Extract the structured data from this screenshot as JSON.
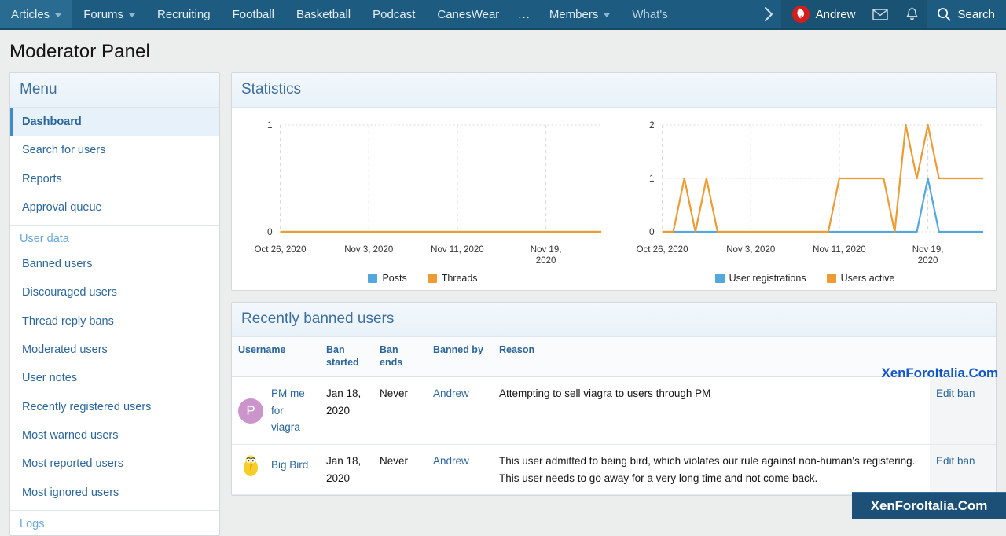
{
  "navbar": {
    "items": [
      {
        "label": "Articles",
        "has_caret": true
      },
      {
        "label": "Forums",
        "has_caret": true
      },
      {
        "label": "Recruiting",
        "has_caret": false
      },
      {
        "label": "Football",
        "has_caret": false
      },
      {
        "label": "Basketball",
        "has_caret": false
      },
      {
        "label": "Podcast",
        "has_caret": false
      },
      {
        "label": "CanesWear",
        "has_caret": false
      },
      {
        "label": "...",
        "has_caret": false
      },
      {
        "label": "Members",
        "has_caret": true
      },
      {
        "label": "What's",
        "has_caret": false
      }
    ],
    "scroll_right_icon": "chevron-right-icon",
    "username": "Andrew",
    "inbox_icon": "envelope-icon",
    "alerts_icon": "bell-icon",
    "search_label": "Search",
    "search_icon": "magnifier-icon",
    "bg_color": "#1e5b80",
    "avatar_color": "#d41e1e"
  },
  "page": {
    "title": "Moderator Panel"
  },
  "sidebar": {
    "header": "Menu",
    "items": [
      {
        "label": "Dashboard",
        "active": true,
        "type": "item"
      },
      {
        "label": "Search for users",
        "active": false,
        "type": "item"
      },
      {
        "label": "Reports",
        "active": false,
        "type": "item"
      },
      {
        "label": "Approval queue",
        "active": false,
        "type": "item"
      },
      {
        "label": "User data",
        "active": false,
        "type": "section"
      },
      {
        "label": "Banned users",
        "active": false,
        "type": "item"
      },
      {
        "label": "Discouraged users",
        "active": false,
        "type": "item"
      },
      {
        "label": "Thread reply bans",
        "active": false,
        "type": "item"
      },
      {
        "label": "Moderated users",
        "active": false,
        "type": "item"
      },
      {
        "label": "User notes",
        "active": false,
        "type": "item"
      },
      {
        "label": "Recently registered users",
        "active": false,
        "type": "item"
      },
      {
        "label": "Most warned users",
        "active": false,
        "type": "item"
      },
      {
        "label": "Most reported users",
        "active": false,
        "type": "item"
      },
      {
        "label": "Most ignored users",
        "active": false,
        "type": "item"
      },
      {
        "label": "Logs",
        "active": false,
        "type": "section"
      }
    ]
  },
  "statistics": {
    "header": "Statistics"
  },
  "banned": {
    "header": "Recently banned users",
    "columns": [
      "Username",
      "Ban started",
      "Ban ends",
      "Banned by",
      "Reason",
      ""
    ],
    "rows": [
      {
        "username": "PM me for viagra",
        "avatar_letter": "P",
        "avatar_type": "letter",
        "avatar_color": "#cb95cb",
        "ban_started": "Jan 18, 2020",
        "ban_ends": "Never",
        "banned_by": "Andrew",
        "reason": "Attempting to sell viagra to users through PM",
        "edit_label": "Edit ban"
      },
      {
        "username": "Big Bird",
        "avatar_letter": "",
        "avatar_type": "image",
        "avatar_color": "#f2c200",
        "ban_started": "Jan 18, 2020",
        "ban_ends": "Never",
        "banned_by": "Andrew",
        "reason": "This user admitted to being bird, which violates our rule against non-human's registering. This user needs to go away for a very long time and not come back.",
        "edit_label": "Edit ban"
      }
    ]
  },
  "watermark": {
    "inline": "XenForoItalia.Com",
    "banner": "XenForoItalia.Com"
  },
  "chart_data": [
    {
      "type": "line",
      "title": "Statistics - content",
      "xlabel": "",
      "ylabel": "",
      "ylim": [
        0,
        1
      ],
      "yticks": [
        0,
        1
      ],
      "grid": true,
      "legend_position": "bottom",
      "x_tick_labels": [
        "Oct 26, 2020",
        "Nov 3, 2020",
        "Nov 11, 2020",
        "Nov 19, 2020"
      ],
      "x_tick_positions": [
        0,
        8,
        16,
        24
      ],
      "x": [
        0,
        1,
        2,
        3,
        4,
        5,
        6,
        7,
        8,
        9,
        10,
        11,
        12,
        13,
        14,
        15,
        16,
        17,
        18,
        19,
        20,
        21,
        22,
        23,
        24,
        25,
        26,
        27,
        28,
        29
      ],
      "series": [
        {
          "name": "Posts",
          "color": "#54a7dd",
          "values": [
            0,
            0,
            0,
            0,
            0,
            0,
            0,
            0,
            0,
            0,
            0,
            0,
            0,
            0,
            0,
            0,
            0,
            0,
            0,
            0,
            0,
            0,
            0,
            0,
            0,
            0,
            0,
            0,
            0,
            0
          ]
        },
        {
          "name": "Threads",
          "color": "#ed9b33",
          "values": [
            0,
            0,
            0,
            0,
            0,
            0,
            0,
            0,
            0,
            0,
            0,
            0,
            0,
            0,
            0,
            0,
            0,
            0,
            0,
            0,
            0,
            0,
            0,
            0,
            0,
            0,
            0,
            0,
            0,
            0
          ]
        }
      ]
    },
    {
      "type": "line",
      "title": "Statistics - users",
      "xlabel": "",
      "ylabel": "",
      "ylim": [
        0,
        2
      ],
      "yticks": [
        0,
        1,
        2
      ],
      "grid": true,
      "legend_position": "bottom",
      "x_tick_labels": [
        "Oct 26, 2020",
        "Nov 3, 2020",
        "Nov 11, 2020",
        "Nov 19, 2020"
      ],
      "x_tick_positions": [
        0,
        8,
        16,
        24
      ],
      "x": [
        0,
        1,
        2,
        3,
        4,
        5,
        6,
        7,
        8,
        9,
        10,
        11,
        12,
        13,
        14,
        15,
        16,
        17,
        18,
        19,
        20,
        21,
        22,
        23,
        24,
        25,
        26,
        27,
        28,
        29
      ],
      "series": [
        {
          "name": "User registrations",
          "color": "#54a7dd",
          "values": [
            0,
            0,
            0,
            0,
            0,
            0,
            0,
            0,
            0,
            0,
            0,
            0,
            0,
            0,
            0,
            0,
            0,
            0,
            0,
            0,
            0,
            0,
            0,
            0,
            1,
            0,
            0,
            0,
            0,
            0
          ]
        },
        {
          "name": "Users active",
          "color": "#ed9b33",
          "values": [
            0,
            0,
            1,
            0,
            1,
            0,
            0,
            0,
            0,
            0,
            0,
            0,
            0,
            0,
            0,
            0,
            1,
            1,
            1,
            1,
            1,
            0,
            2,
            1,
            2,
            1,
            1,
            1,
            1,
            1
          ]
        }
      ]
    }
  ]
}
